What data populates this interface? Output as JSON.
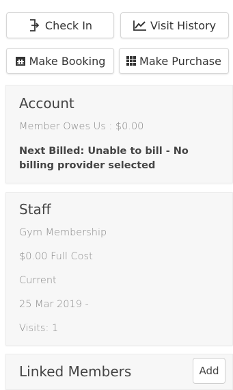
{
  "actions": {
    "check_in": {
      "label": "Check In",
      "icon": "sign-in-icon"
    },
    "visit_history": {
      "label": "Visit History",
      "icon": "line-chart-icon"
    },
    "make_booking": {
      "label": "Make Booking",
      "icon": "calendar-icon"
    },
    "make_purchase": {
      "label": "Make Purchase",
      "icon": "grid-icon"
    }
  },
  "account": {
    "title": "Account",
    "owes": "Member Owes Us : $0.00",
    "next_billed": "Next Billed: Unable to bill - No billing provider selected"
  },
  "staff": {
    "title": "Staff",
    "membership": "Gym Membership",
    "cost": "$0.00 Full Cost",
    "status": "Current",
    "date": "25 Mar 2019 -",
    "visits": "Visits: 1"
  },
  "linked_members": {
    "title": "Linked Members",
    "add_label": "Add"
  }
}
